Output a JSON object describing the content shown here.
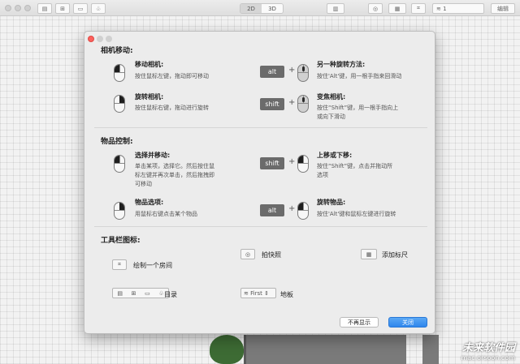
{
  "toolbar": {
    "view_2d": "2D",
    "view_3d": "3D",
    "floor_value": "1",
    "edit_label": "编辑"
  },
  "watermark": {
    "logo_text": "未来软件园",
    "site": "mac.orsoon.com"
  },
  "dialog": {
    "camera_section": {
      "title": "相机移动:",
      "move": {
        "title": "移动相机:",
        "desc": "按住鼠标左键，拖动即可移动"
      },
      "rotate_alt": {
        "key": "alt",
        "title": "另一种旋转方法:",
        "desc": "按住'Alt'键，用一根手指来回滑动"
      },
      "rotate": {
        "title": "旋转相机:",
        "desc": "按住鼠标右键，拖动进行旋转"
      },
      "zoom": {
        "key": "shift",
        "title": "变焦相机:",
        "desc_line1": "按住“Shift”键，用一根手指向上",
        "desc_line2": "或向下滑动"
      }
    },
    "object_section": {
      "title": "物品控制:",
      "select": {
        "title": "选择并移动:",
        "desc_line1": "单击某项，选择它。然后按住鼠",
        "desc_line2": "标左键并再次单击，然后拖拽即",
        "desc_line3": "可移动"
      },
      "updown": {
        "key": "shift",
        "title": "上移或下移:",
        "desc_line1": "按住“Shift”键，点击并拖动所",
        "desc_line2": "选项"
      },
      "options": {
        "title": "物品选项:",
        "desc": "用鼠标右键点击某个物品"
      },
      "rotate_item": {
        "key": "alt",
        "title": "旋转物品:",
        "desc": "按住'Alt'键和鼠标左键进行旋转"
      }
    },
    "toolbar_section": {
      "title": "工具栏图标:",
      "snapshot": "拍快照",
      "ruler": "添加标尺",
      "draw_room": "绘制一个房间",
      "catalog": "目录",
      "floor_select": "First",
      "floor": "地板"
    },
    "buttons": {
      "dont_show": "不再显示",
      "close": "关闭"
    }
  },
  "colors": {
    "primary_button": "#2f86ec",
    "close_dot": "#fc605c",
    "key_bg": "#6b6b6b"
  }
}
